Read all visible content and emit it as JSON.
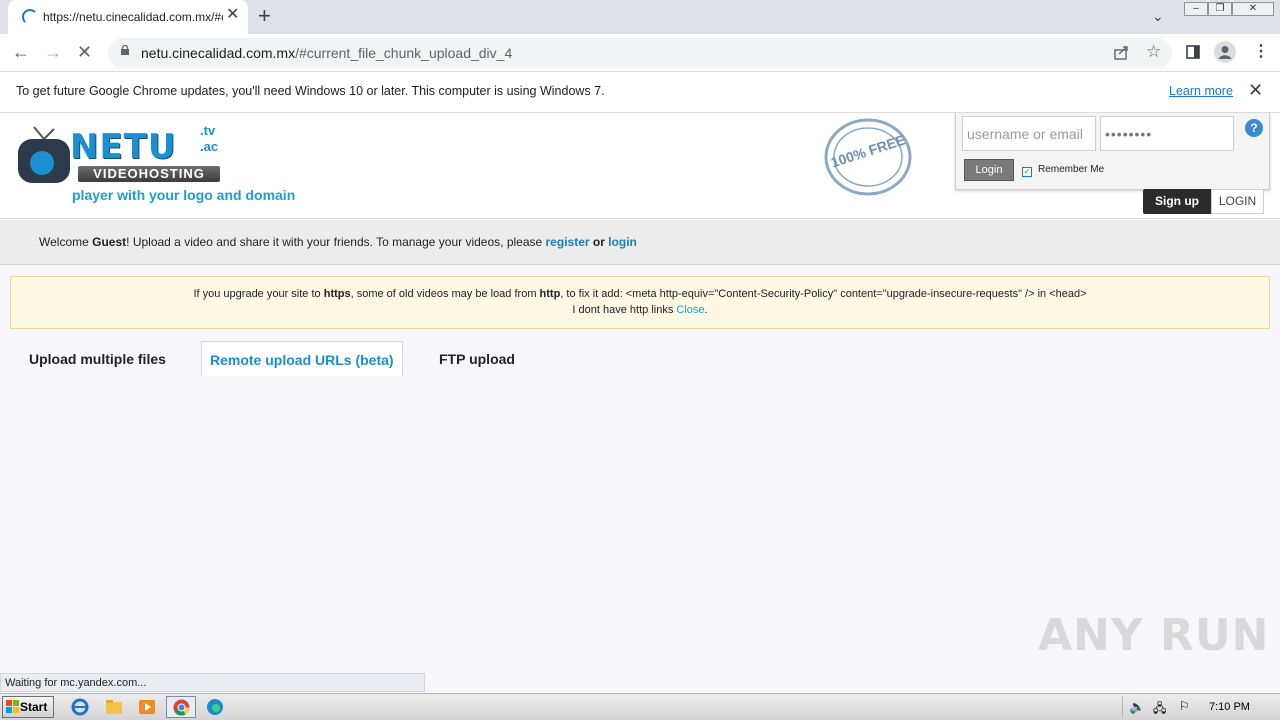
{
  "browser": {
    "tab_title": "https://netu.cinecalidad.com.mx/#c",
    "url_host": "netu.cinecalidad.com.mx",
    "url_path": "/#current_file_chunk_upload_div_4",
    "infobar_message": "To get future Google Chrome updates, you'll need Windows 10 or later. This computer is using Windows 7.",
    "infobar_link": "Learn more",
    "status_text": "Waiting for mc.yandex.com..."
  },
  "site": {
    "logo": {
      "name": "NETU",
      "tld_1": ".tv",
      "tld_2": ".ac",
      "subtitle": "VIDEOHOSTING",
      "tagline": "player with your logo and domain"
    },
    "stamp": "100% FREE",
    "login": {
      "username_placeholder": "username or email",
      "password_value": "••••••••",
      "login_button": "Login",
      "remember_label": "Remember Me",
      "help": "?"
    },
    "signup_label": "Sign up",
    "login_tab_label": "LOGIN",
    "welcome": {
      "prefix": "Welcome ",
      "guest": "Guest",
      "middle": "! Upload a video and share it with your friends. To manage your videos, please ",
      "register": "register",
      "or": " or ",
      "login": "login"
    },
    "notice": {
      "l1_a": "If you upgrade your site to ",
      "l1_https": "https",
      "l1_b": ", some of old videos may be load from ",
      "l1_http": "http",
      "l1_c": ", to fix it add: <meta http-equiv=\"Content-Security-Policy\" content=\"upgrade-insecure-requests\" /> in <head>",
      "l2": "I dont have http links ",
      "close": "Close",
      "period": "."
    },
    "tabs": [
      {
        "label": "Upload multiple files"
      },
      {
        "label": "Remote upload URLs (beta)"
      },
      {
        "label": "FTP upload"
      }
    ]
  },
  "watermark": "ANY RUN",
  "taskbar": {
    "start": "Start",
    "clock": "7:10 PM"
  }
}
